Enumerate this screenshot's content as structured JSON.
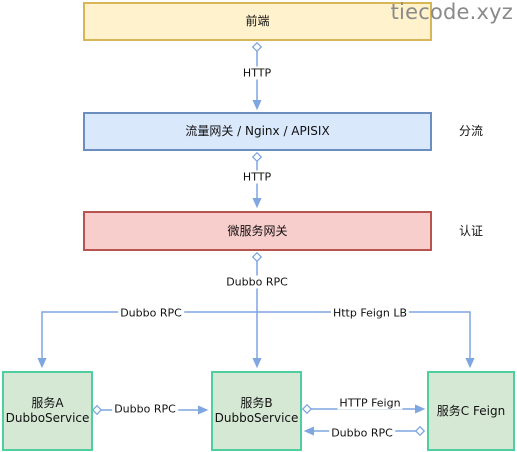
{
  "watermark": "tiecode.xyz",
  "colors": {
    "line": "#7ea6e0",
    "edge_line": "#6c8ebf",
    "frontend_fill": "#fff2cc",
    "frontend_border": "#d6b656",
    "traffic_fill": "#dae8fc",
    "traffic_border": "#6c8ebf",
    "gateway_fill": "#f8cecc",
    "gateway_border": "#b85450",
    "service_fill": "#d5e8d4",
    "service_border": "#4fcf9f"
  },
  "nodes": {
    "frontend": {
      "label": "前端"
    },
    "traffic_gateway": {
      "label": "流量网关 / Nginx / APISIX"
    },
    "micro_gateway": {
      "label": "微服务网关"
    },
    "service_a": {
      "line1": "服务A",
      "line2": "DubboService"
    },
    "service_b": {
      "line1": "服务B",
      "line2": "DubboService"
    },
    "service_c": {
      "label": "服务C Feign"
    }
  },
  "side_labels": {
    "traffic": "分流",
    "gateway": "认证"
  },
  "edges": {
    "frontend_to_traffic": "HTTP",
    "traffic_to_gateway": "HTTP",
    "gateway_to_b": "Dubbo RPC",
    "gateway_to_a": "Dubbo RPC",
    "gateway_to_c": "Http Feign LB",
    "a_to_b": "Dubbo RPC",
    "b_to_c": "HTTP Feign",
    "c_to_b": "Dubbo RPC"
  }
}
